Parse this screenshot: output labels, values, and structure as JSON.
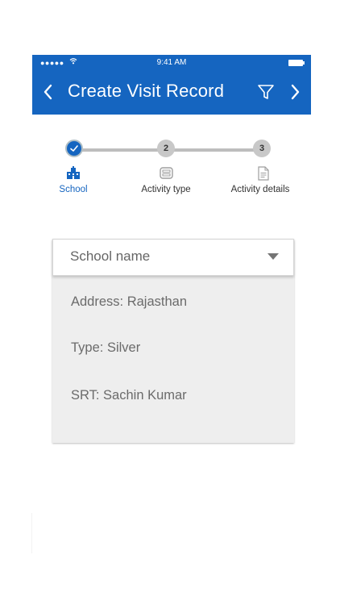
{
  "status_bar": {
    "signal": "●●●●●",
    "time": "9:41 AM"
  },
  "header": {
    "title": "Create Visit Record",
    "background_color": "#1565c0",
    "back_icon": "chevron-left-icon",
    "filter_icon": "filter-icon",
    "forward_icon": "chevron-right-icon"
  },
  "stepper": {
    "steps": [
      {
        "number": "",
        "label": "School",
        "status": "completed",
        "icon": "school-building-icon"
      },
      {
        "number": "2",
        "label": "Activity type",
        "status": "pending",
        "icon": "activity-list-icon"
      },
      {
        "number": "3",
        "label": "Activity details",
        "status": "pending",
        "icon": "document-icon"
      }
    ],
    "active_color": "#1565c0"
  },
  "school_card": {
    "select_placeholder": "School name",
    "address": "Address: Rajasthan",
    "type": "Type: Silver",
    "srt": "SRT: Sachin Kumar"
  }
}
